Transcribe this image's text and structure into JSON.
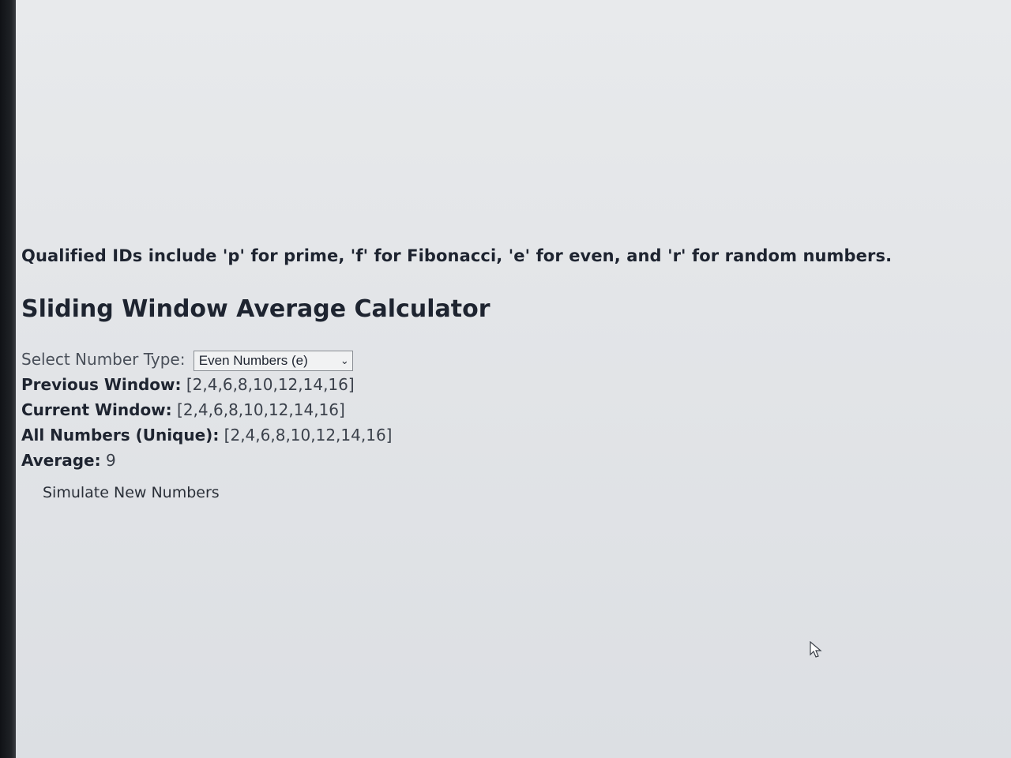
{
  "intro_text": "Qualified IDs include 'p' for prime, 'f' for Fibonacci, 'e' for even, and 'r' for random numbers.",
  "title": "Sliding Window Average Calculator",
  "select": {
    "label": "Select Number Type:",
    "selected": "Even Numbers (e)"
  },
  "previous_window": {
    "label": "Previous Window:",
    "value": "[2,4,6,8,10,12,14,16]"
  },
  "current_window": {
    "label": "Current Window:",
    "value": "[2,4,6,8,10,12,14,16]"
  },
  "all_numbers": {
    "label": "All Numbers (Unique):",
    "value": "[2,4,6,8,10,12,14,16]"
  },
  "average": {
    "label": "Average:",
    "value": "9"
  },
  "simulate_button": "Simulate New Numbers",
  "icons": {
    "dropdown": "chevron-down-icon",
    "cursor": "mouse-pointer-icon"
  }
}
